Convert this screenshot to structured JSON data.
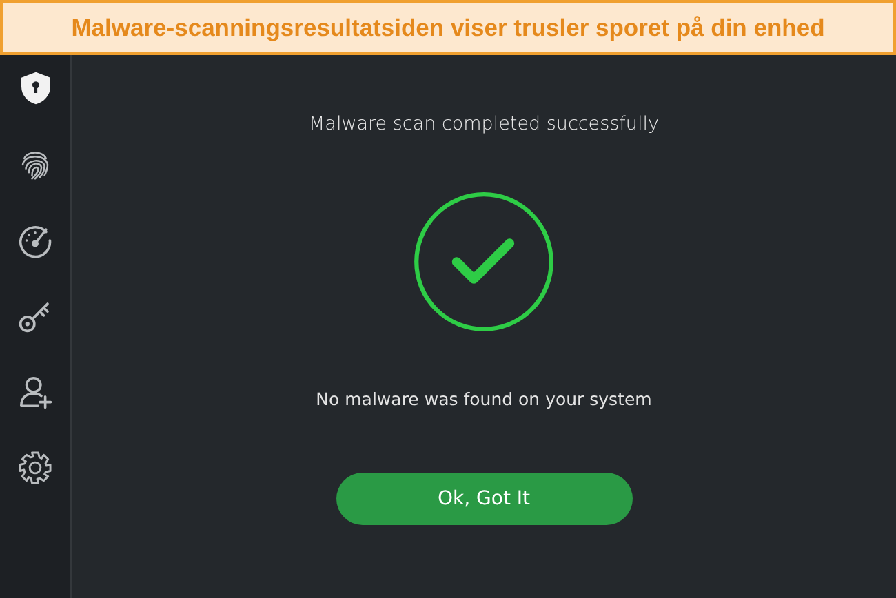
{
  "caption": "Malware-scanningsresultatsiden viser trusler sporet på din enhed",
  "sidebar": {
    "items": [
      {
        "kind": "shield",
        "selected": true
      },
      {
        "kind": "fingerprint",
        "selected": false
      },
      {
        "kind": "gauge",
        "selected": false
      },
      {
        "kind": "key",
        "selected": false
      },
      {
        "kind": "useradd",
        "selected": false
      },
      {
        "kind": "gear",
        "selected": false
      }
    ]
  },
  "result": {
    "title": "Malware scan completed successfully",
    "message": "No malware was found on your system",
    "button": "Ok, Got It"
  }
}
